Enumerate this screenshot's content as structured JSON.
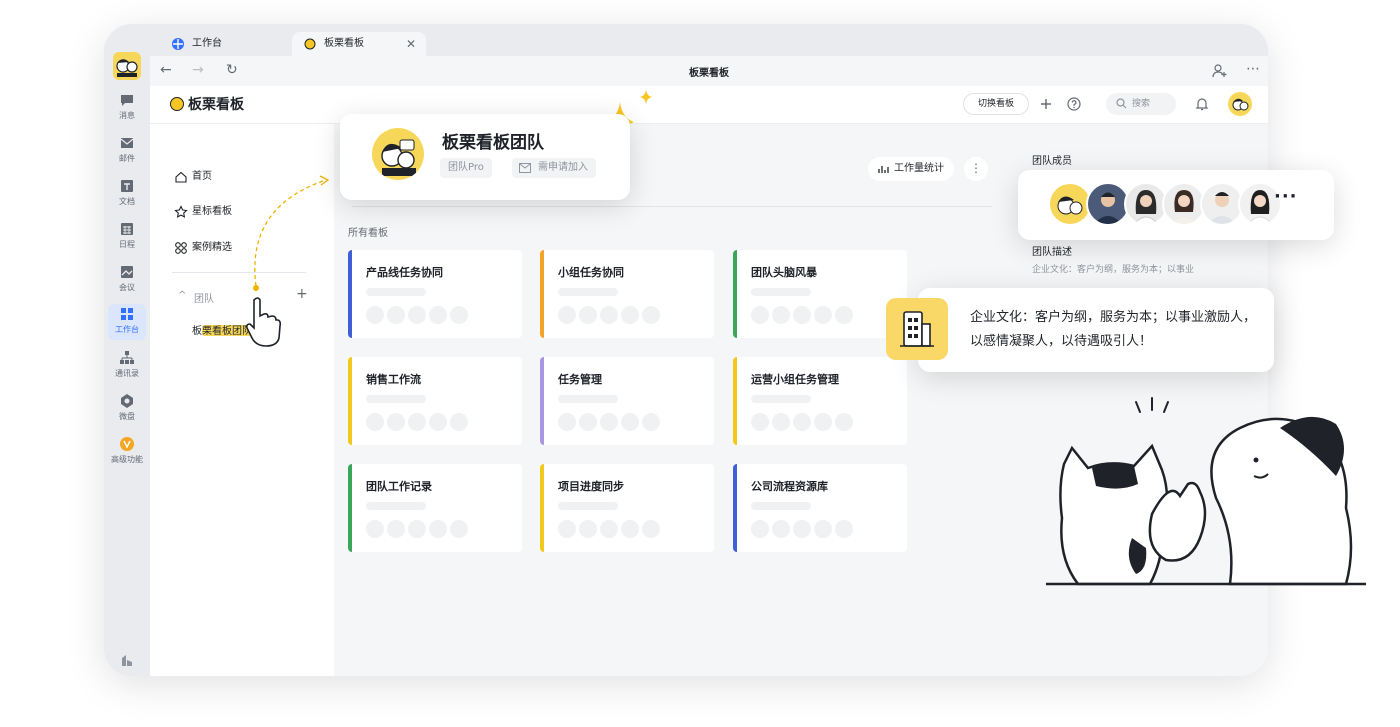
{
  "rail": {
    "items": [
      {
        "label": "消息",
        "icon": "chat-icon"
      },
      {
        "label": "邮件",
        "icon": "mail-icon"
      },
      {
        "label": "文档",
        "icon": "doc-icon"
      },
      {
        "label": "日程",
        "icon": "calendar-icon"
      },
      {
        "label": "会议",
        "icon": "meeting-icon"
      },
      {
        "label": "工作台",
        "icon": "workbench-icon",
        "active": true
      },
      {
        "label": "通讯录",
        "icon": "contacts-icon"
      },
      {
        "label": "微盘",
        "icon": "drive-icon"
      },
      {
        "label": "高级功能",
        "icon": "premium-icon"
      }
    ]
  },
  "tabs": [
    {
      "label": "工作台"
    },
    {
      "label": "板栗看板"
    }
  ],
  "address": {
    "title": "板栗看板"
  },
  "app": {
    "title": "板栗看板",
    "switch_label": "切换看板",
    "search_placeholder": "搜索"
  },
  "sidebar": {
    "items": [
      {
        "label": "首页"
      },
      {
        "label": "星标看板"
      },
      {
        "label": "案例精选"
      }
    ],
    "team_section": "团队",
    "team_name": "板栗看板团队"
  },
  "main": {
    "stat_label": "工作量统计",
    "more_label": "⋮",
    "all_boards": "所有看板",
    "boards": [
      {
        "title": "产品线任务协同",
        "color": "#3f5fd6"
      },
      {
        "title": "小组任务协同",
        "color": "#f3a32a"
      },
      {
        "title": "团队头脑风暴",
        "color": "#3aa65a"
      },
      {
        "title": "销售工作流",
        "color": "#f2c81e"
      },
      {
        "title": "任务管理",
        "color": "#a897e0"
      },
      {
        "title": "运营小组任务管理",
        "color": "#f2c81e"
      },
      {
        "title": "团队工作记录",
        "color": "#3aa65a"
      },
      {
        "title": "项目进度同步",
        "color": "#f2c81e"
      },
      {
        "title": "公司流程资源库",
        "color": "#3f5fd6"
      }
    ]
  },
  "right": {
    "members_title": "团队成员",
    "desc_title": "团队描述",
    "desc_text": "企业文化：客户为纲，服务为本；以事业"
  },
  "popup_team": {
    "title": "板栗看板团队",
    "tag_pro": "团队Pro",
    "tag_join": "需申请加入"
  },
  "popup_members": {
    "more": "···"
  },
  "popup_desc": {
    "text": "企业文化：客户为纲，服务为本；以事业激励人，以感情凝聚人，以待遇吸引人！"
  },
  "colors": {
    "accent": "#3370ff",
    "brand_yellow": "#f7d75a"
  }
}
